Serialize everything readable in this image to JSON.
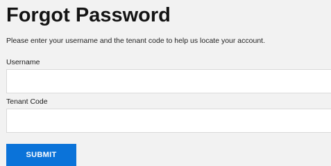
{
  "page": {
    "title": "Forgot Password",
    "instructions": "Please enter your username and the tenant code to help us locate your account."
  },
  "form": {
    "username": {
      "label": "Username",
      "value": "",
      "placeholder": ""
    },
    "tenant_code": {
      "label": "Tenant Code",
      "value": "",
      "placeholder": ""
    },
    "submit_label": "SUBMIT"
  },
  "colors": {
    "background": "#f2f2f2",
    "input_background": "#ffffff",
    "input_border": "#d9d9d9",
    "button_background": "#0b73d9",
    "button_text": "#ffffff"
  }
}
